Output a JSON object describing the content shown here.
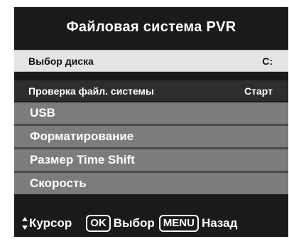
{
  "title": "Файловая система PVR",
  "disk": {
    "label": "Выбор диска",
    "value": "C:"
  },
  "check": {
    "label": "Проверка файл. системы",
    "value": "Старт"
  },
  "menu": [
    {
      "label": "USB"
    },
    {
      "label": "Форматирование"
    },
    {
      "label": "Размер Time Shift"
    },
    {
      "label": "Скорость"
    }
  ],
  "footer": {
    "cursor_label": "Курсор",
    "ok_key": "OK",
    "ok_label": "Выбор",
    "menu_key": "MENU",
    "menu_label": "Назад"
  },
  "colors": {
    "panel": "#1a1a1a",
    "selected_row": "#e4e4e4",
    "menu_row": "#7c7c7c"
  }
}
